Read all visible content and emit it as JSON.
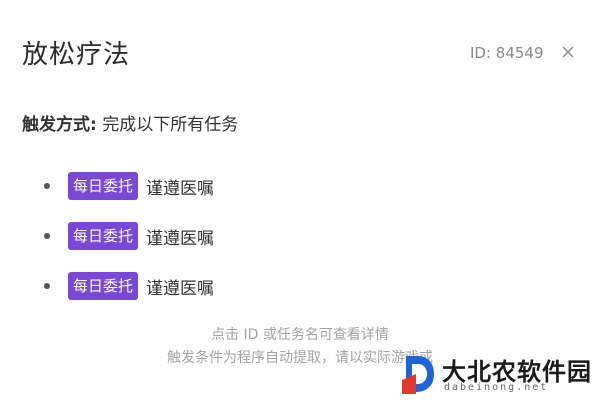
{
  "header": {
    "title": "放松疗法",
    "task_id": "ID: 84549"
  },
  "trigger": {
    "label": "触发方式:",
    "value": "完成以下所有任务"
  },
  "tasks": [
    {
      "badge": "每日委托",
      "name": "谨遵医嘱"
    },
    {
      "badge": "每日委托",
      "name": "谨遵医嘱"
    },
    {
      "badge": "每日委托",
      "name": "谨遵医嘱"
    }
  ],
  "footer": {
    "hint_line1": "点击 ID 或任务名可查看详情",
    "hint_line2": "触发条件为程序自动提取，请以实际游戏或"
  },
  "watermark": {
    "name": "大北农软件园",
    "domain": "dabeinong.net"
  },
  "colors": {
    "badge_bg": "#7a48d6",
    "logo_blue": "#1e64d8",
    "logo_red": "#e0392b"
  },
  "icons": {
    "close": "close-icon",
    "bullet": "bullet-dot-icon",
    "logo": "watermark-logo-icon"
  }
}
